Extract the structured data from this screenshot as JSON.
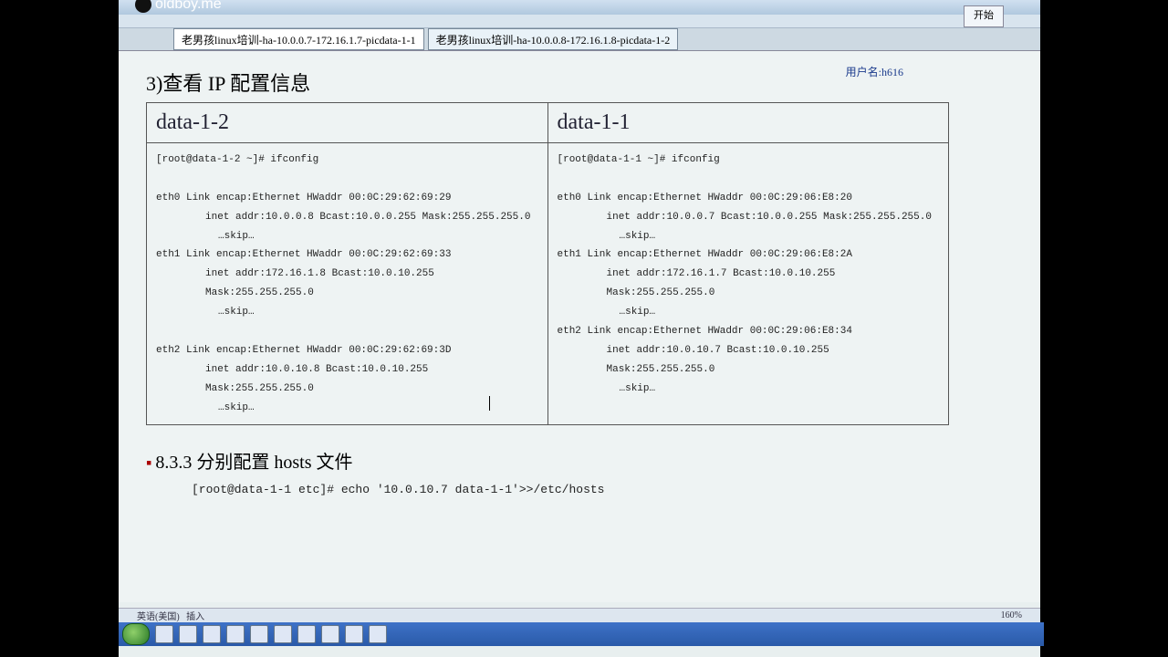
{
  "watermark": "oldboy.me",
  "tabs": [
    {
      "label": "老男孩linux培训-ha-10.0.0.7-172.16.1.7-picdata-1-1"
    },
    {
      "label": "老男孩linux培训-ha-10.0.0.8-172.16.1.8-picdata-1-2"
    }
  ],
  "topRightButton": "开始",
  "username": "用户名:h616",
  "sectionHeading": "3)查看 IP 配置信息",
  "left": {
    "title": "data-1-2",
    "prompt": "[root@data-1-2 ~]# ifconfig",
    "if0_line": "eth0      Link encap:Ethernet   HWaddr 00:0C:29:62:69:29",
    "if0_addr": "inet addr:10.0.0.8   Bcast:10.0.0.255   Mask:255.255.255.0",
    "skip": "…skip…",
    "if1_line": "eth1      Link encap:Ethernet   HWaddr 00:0C:29:62:69:33",
    "if1_addr": "inet addr:172.16.1.8   Bcast:10.0.10.255   Mask:255.255.255.0",
    "if2_line": "eth2      Link encap:Ethernet   HWaddr 00:0C:29:62:69:3D",
    "if2_addr": "inet addr:10.0.10.8   Bcast:10.0.10.255   Mask:255.255.255.0"
  },
  "right": {
    "title": "data-1-1",
    "prompt": "[root@data-1-1 ~]# ifconfig",
    "if0_line": "eth0      Link encap:Ethernet   HWaddr 00:0C:29:06:E8:20",
    "if0_addr": "inet addr:10.0.0.7   Bcast:10.0.0.255   Mask:255.255.255.0",
    "skip": "…skip…",
    "if1_line": "eth1      Link encap:Ethernet   HWaddr 00:0C:29:06:E8:2A",
    "if1_addr": "inet addr:172.16.1.7   Bcast:10.0.10.255   Mask:255.255.255.0",
    "if2_line": "eth2      Link encap:Ethernet   HWaddr 00:0C:29:06:E8:34",
    "if2_addr": "inet addr:10.0.10.7   Bcast:10.0.10.255   Mask:255.255.255.0"
  },
  "section2": "8.3.3  分别配置 hosts 文件",
  "cmd": "[root@data-1-1 etc]# echo '10.0.10.7 data-1-1'>>/etc/hosts",
  "status": {
    "lang": "英语(美国)",
    "mode": "插入",
    "zoom": "160%"
  }
}
